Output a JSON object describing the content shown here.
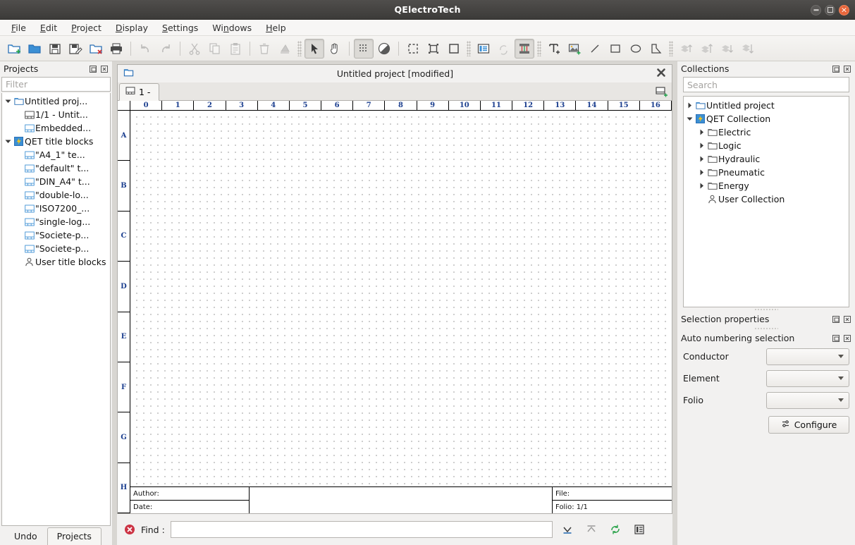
{
  "window": {
    "title": "QElectroTech",
    "controls": {
      "minimize": "minimize",
      "maximize": "maximize",
      "close": "close"
    }
  },
  "menubar": {
    "items": [
      {
        "label": "File",
        "mnemonic": "F"
      },
      {
        "label": "Edit",
        "mnemonic": "E"
      },
      {
        "label": "Project",
        "mnemonic": "P"
      },
      {
        "label": "Display",
        "mnemonic": "D"
      },
      {
        "label": "Settings",
        "mnemonic": "S"
      },
      {
        "label": "Windows",
        "mnemonic": "n"
      },
      {
        "label": "Help",
        "mnemonic": "H"
      }
    ]
  },
  "toolbar": {
    "items": [
      {
        "name": "new-project-icon",
        "state": "enabled"
      },
      {
        "name": "open-project-icon",
        "state": "enabled"
      },
      {
        "name": "save-icon",
        "state": "enabled"
      },
      {
        "name": "save-as-icon",
        "state": "enabled"
      },
      {
        "name": "close-project-icon",
        "state": "enabled"
      },
      {
        "name": "print-icon",
        "state": "enabled"
      },
      {
        "name": "undo-icon",
        "state": "disabled"
      },
      {
        "name": "redo-icon",
        "state": "disabled"
      },
      {
        "name": "cut-icon",
        "state": "disabled"
      },
      {
        "name": "copy-icon",
        "state": "disabled"
      },
      {
        "name": "paste-icon",
        "state": "disabled"
      },
      {
        "name": "delete-icon",
        "state": "disabled"
      },
      {
        "name": "rotate-icon",
        "state": "disabled"
      },
      {
        "name": "select-tool-icon",
        "state": "active"
      },
      {
        "name": "pan-tool-icon",
        "state": "enabled"
      },
      {
        "name": "grid-toggle-icon",
        "state": "active"
      },
      {
        "name": "contrast-icon",
        "state": "enabled"
      },
      {
        "name": "zoom-fit-icon",
        "state": "enabled"
      },
      {
        "name": "zoom-selection-icon",
        "state": "enabled"
      },
      {
        "name": "zoom-reset-icon",
        "state": "enabled"
      },
      {
        "name": "folio-list-icon",
        "state": "enabled"
      },
      {
        "name": "refresh-icon",
        "state": "disabled"
      },
      {
        "name": "terminal-block-icon",
        "state": "active"
      },
      {
        "name": "add-text-icon",
        "state": "enabled"
      },
      {
        "name": "add-image-icon",
        "state": "enabled"
      },
      {
        "name": "add-line-icon",
        "state": "enabled"
      },
      {
        "name": "add-rectangle-icon",
        "state": "enabled"
      },
      {
        "name": "add-ellipse-icon",
        "state": "enabled"
      },
      {
        "name": "add-polygon-icon",
        "state": "enabled"
      },
      {
        "name": "raise-icon",
        "state": "disabled"
      },
      {
        "name": "bring-to-front-icon",
        "state": "disabled"
      },
      {
        "name": "lower-icon",
        "state": "disabled"
      },
      {
        "name": "send-to-back-icon",
        "state": "disabled"
      }
    ]
  },
  "projects_dock": {
    "title": "Projects",
    "filter": {
      "value": "",
      "placeholder": "Filter"
    },
    "tree": [
      {
        "label": "Untitled proj...",
        "icon": "folder-open-icon",
        "depth": 0,
        "expander": "expanded"
      },
      {
        "label": "1/1 - Untit...",
        "icon": "folio-icon",
        "depth": 1,
        "expander": "none"
      },
      {
        "label": "Embedded...",
        "icon": "title-block-icon",
        "depth": 1,
        "expander": "none"
      },
      {
        "label": "QET title blocks",
        "icon": "qet-icon",
        "depth": 0,
        "expander": "expanded"
      },
      {
        "label": "\"A4_1\" te...",
        "icon": "title-block-icon",
        "depth": 1,
        "expander": "none"
      },
      {
        "label": "\"default\" t...",
        "icon": "title-block-icon",
        "depth": 1,
        "expander": "none"
      },
      {
        "label": "\"DIN_A4\" t...",
        "icon": "title-block-icon",
        "depth": 1,
        "expander": "none"
      },
      {
        "label": "\"double-lo...",
        "icon": "title-block-icon",
        "depth": 1,
        "expander": "none"
      },
      {
        "label": "\"ISO7200_...",
        "icon": "title-block-icon",
        "depth": 1,
        "expander": "none"
      },
      {
        "label": "\"single-log...",
        "icon": "title-block-icon",
        "depth": 1,
        "expander": "none"
      },
      {
        "label": "\"Societe-p...",
        "icon": "title-block-icon",
        "depth": 1,
        "expander": "none"
      },
      {
        "label": "\"Societe-p...",
        "icon": "title-block-icon",
        "depth": 1,
        "expander": "none"
      },
      {
        "label": "User title blocks",
        "icon": "user-icon",
        "depth": 1,
        "expander": "none"
      }
    ],
    "tabs": [
      {
        "label": "Undo",
        "selected": false
      },
      {
        "label": "Projects",
        "selected": true
      }
    ]
  },
  "mdi": {
    "title": "Untitled project [modified]",
    "close_label": "close",
    "folio_tabs": [
      {
        "label": "1 -",
        "selected": true
      }
    ],
    "add_folio_label": "add folio"
  },
  "sheet": {
    "columns": [
      "0",
      "1",
      "2",
      "3",
      "4",
      "5",
      "6",
      "7",
      "8",
      "9",
      "10",
      "11",
      "12",
      "13",
      "14",
      "15",
      "16"
    ],
    "rows": [
      "A",
      "B",
      "C",
      "D",
      "E",
      "F",
      "G",
      "H"
    ],
    "title_block": {
      "author_label": "Author:",
      "date_label": "Date:",
      "file_label": "File:",
      "folio_label": "Folio: 1/1"
    }
  },
  "findbar": {
    "label": "Find :",
    "input": {
      "value": "",
      "placeholder": ""
    },
    "buttons": [
      {
        "name": "find-next-icon",
        "state": "enabled"
      },
      {
        "name": "find-previous-icon",
        "state": "disabled"
      },
      {
        "name": "find-refresh-icon",
        "state": "enabled"
      },
      {
        "name": "find-list-icon",
        "state": "enabled"
      }
    ]
  },
  "collections_dock": {
    "title": "Collections",
    "search": {
      "value": "",
      "placeholder": "Search"
    },
    "tree": [
      {
        "label": "Untitled project",
        "icon": "folder-open-icon",
        "depth": 0,
        "expander": "collapsed"
      },
      {
        "label": "QET Collection",
        "icon": "qet-icon",
        "depth": 0,
        "expander": "expanded"
      },
      {
        "label": "Electric",
        "icon": "folder-icon",
        "depth": 1,
        "expander": "collapsed"
      },
      {
        "label": "Logic",
        "icon": "folder-icon",
        "depth": 1,
        "expander": "collapsed"
      },
      {
        "label": "Hydraulic",
        "icon": "folder-icon",
        "depth": 1,
        "expander": "collapsed"
      },
      {
        "label": "Pneumatic",
        "icon": "folder-icon",
        "depth": 1,
        "expander": "collapsed"
      },
      {
        "label": "Energy",
        "icon": "folder-icon",
        "depth": 1,
        "expander": "collapsed"
      },
      {
        "label": "User Collection",
        "icon": "user-icon",
        "depth": 1,
        "expander": "none"
      }
    ]
  },
  "selection_dock": {
    "title": "Selection properties"
  },
  "autonumbering_dock": {
    "title": "Auto numbering selection",
    "rows": [
      {
        "label": "Conductor",
        "value": ""
      },
      {
        "label": "Element",
        "value": ""
      },
      {
        "label": "Folio",
        "value": ""
      }
    ],
    "configure_label": "Configure"
  },
  "colors": {
    "titlebar": "#3c3b39",
    "window_bg": "#f2f1f0",
    "canvas": "#ffffff",
    "ruler_text": "#1c3f8f",
    "accent_blue": "#3b7fc4",
    "close_red": "#e8663b"
  }
}
